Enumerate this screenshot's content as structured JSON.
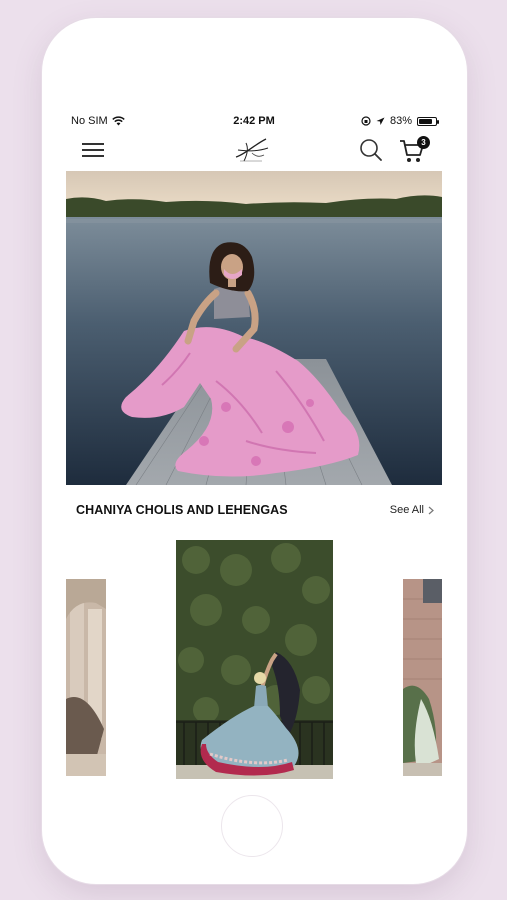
{
  "status_bar": {
    "carrier": "No SIM",
    "time": "2:42 PM",
    "battery": "83%",
    "battery_level": 0.83
  },
  "navbar": {
    "menu_icon": "hamburger-menu-icon",
    "logo_icon": "brand-signature-logo",
    "search_icon": "search-icon",
    "cart_icon": "shopping-cart-icon",
    "cart_count": "3"
  },
  "hero": {
    "image": "woman in pink floral lehenga sitting on a dock by a lake"
  },
  "section": {
    "title": "CHANIYA CHOLIS AND LEHENGAS",
    "see_all": "See All",
    "chevron_icon": "chevron-right-icon"
  },
  "carousel": {
    "items": [
      {
        "image": "woman in cream outfit near stone building (partially visible)"
      },
      {
        "image": "woman twirling in blue and red lehenga in front of ivy wall"
      },
      {
        "image": "woman in pastel outfit by brick wall (partially visible)"
      }
    ]
  },
  "colors": {
    "background": "#ece0ec",
    "phone_body": "#ffffff",
    "text": "#111111"
  }
}
